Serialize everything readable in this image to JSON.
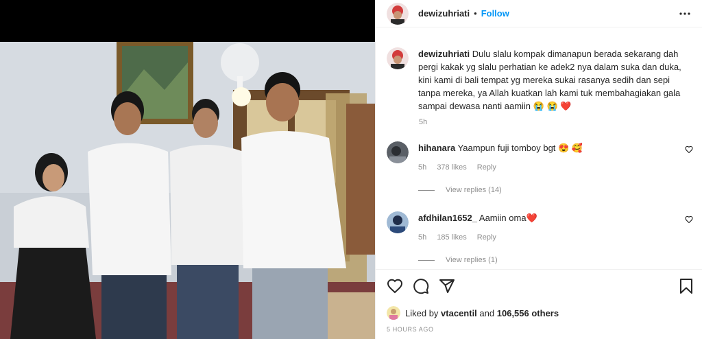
{
  "post": {
    "author": "dewizuhriati",
    "dot": "•",
    "follow_label": "Follow",
    "more_label": "More options"
  },
  "caption": {
    "username": "dewizuhriati",
    "text": "Dulu slalu kompak dimanapun berada sekarang dah pergi kakak yg slalu perhatian ke adek2 nya dalam suka dan duka, kini kami di bali tempat yg mereka sukai rasanya sedih dan sepi tanpa mereka, ya Allah kuatkan lah kami tuk membahagiakan gala sampai dewasa nanti aamiin",
    "emojis": "😭 😭 ❤️",
    "time": "5h"
  },
  "comments": [
    {
      "username": "hihanara",
      "text": "Yaampun fuji tomboy bgt",
      "emojis": "😍 🥰",
      "time": "5h",
      "likes": "378 likes",
      "reply_label": "Reply",
      "view_replies": "View replies (14)"
    },
    {
      "username": "afdhilan1652_",
      "text": "Aamiin oma",
      "emojis": "❤️",
      "time": "5h",
      "likes": "185 likes",
      "reply_label": "Reply",
      "view_replies": "View replies (1)"
    }
  ],
  "likes": {
    "prefix": "Liked by",
    "liker": "vtacentil",
    "and": "and",
    "others": "106,556 others"
  },
  "post_time": "5 HOURS AGO",
  "colors": {
    "link_blue": "#0095f6",
    "secondary_gray": "#8e8e8e",
    "primary_text": "#262626",
    "heart_red": "#ed4956"
  },
  "icons": [
    "heart-icon",
    "comment-icon",
    "share-icon",
    "bookmark-icon",
    "more-icon",
    "heart-small-icon"
  ]
}
